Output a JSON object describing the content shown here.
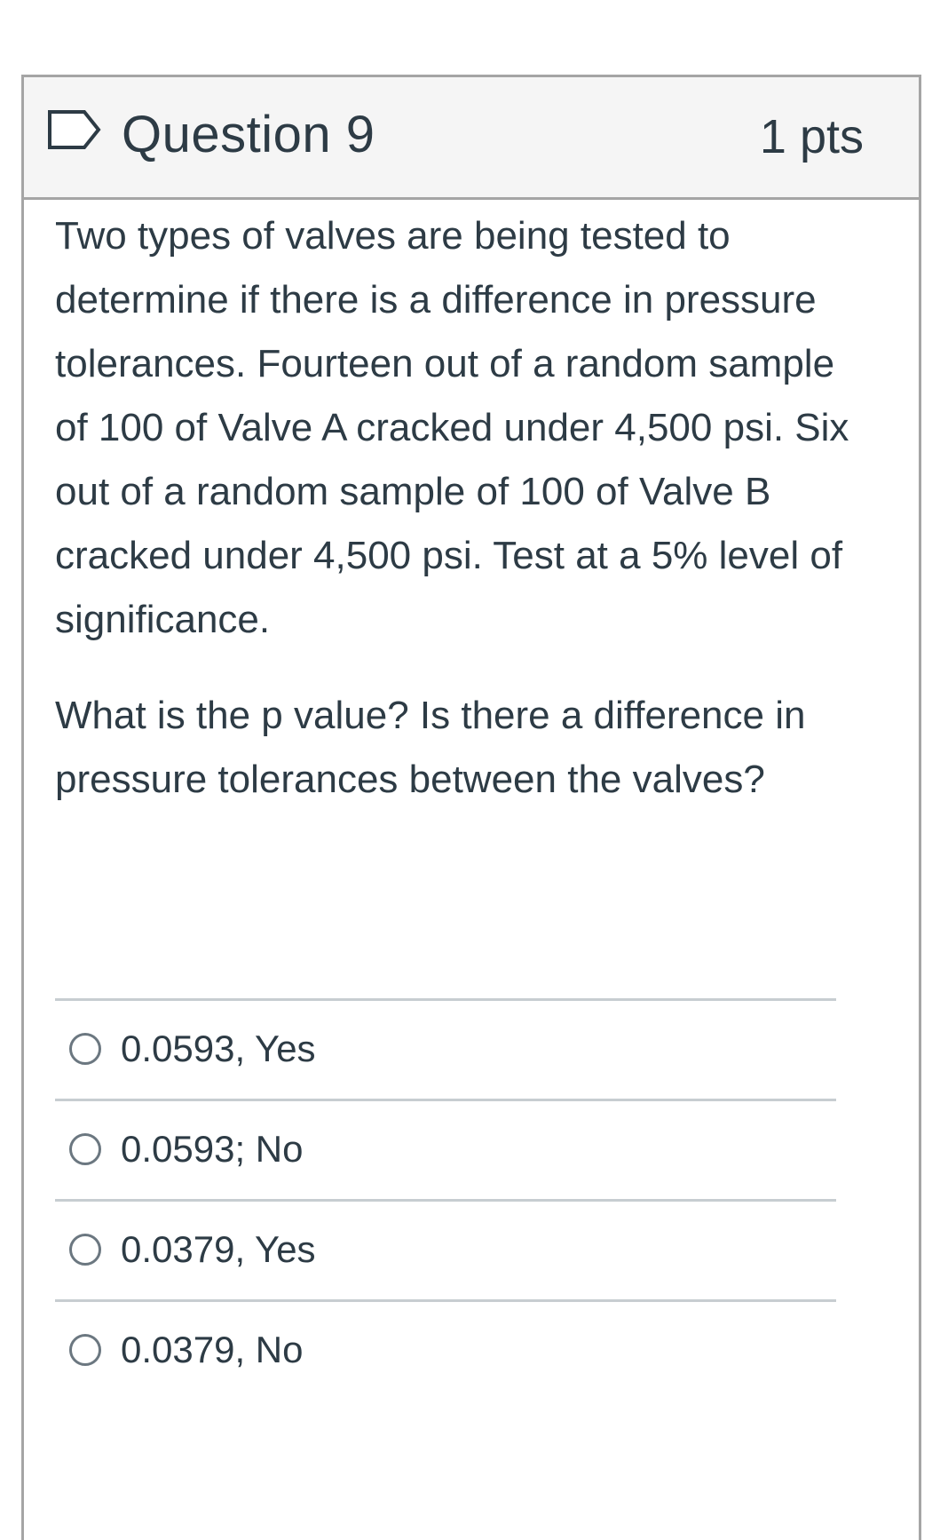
{
  "question": {
    "title": "Question 9",
    "points": "1 pts",
    "flag_icon": "flag-outline-icon",
    "paragraphs": [
      "Two types of valves are being tested to determine if there is a difference in pressure tolerances. Fourteen out of a random sample of 100 of Valve A cracked under 4,500 psi. Six out of a random sample of 100 of Valve B cracked under 4,500 psi. Test at a 5% level of significance."
    ],
    "prompt": "What is the p value? Is there a difference in pressure tolerances between the valves?",
    "answers": [
      {
        "label": "0.0593, Yes"
      },
      {
        "label": "0.0593; No"
      },
      {
        "label": "0.0379, Yes"
      },
      {
        "label": "0.0379, No"
      }
    ]
  },
  "colors": {
    "text": "#2d3b45",
    "header_bg": "#f5f5f5",
    "border": "#a5a5a5",
    "divider": "#c7cdd1"
  }
}
